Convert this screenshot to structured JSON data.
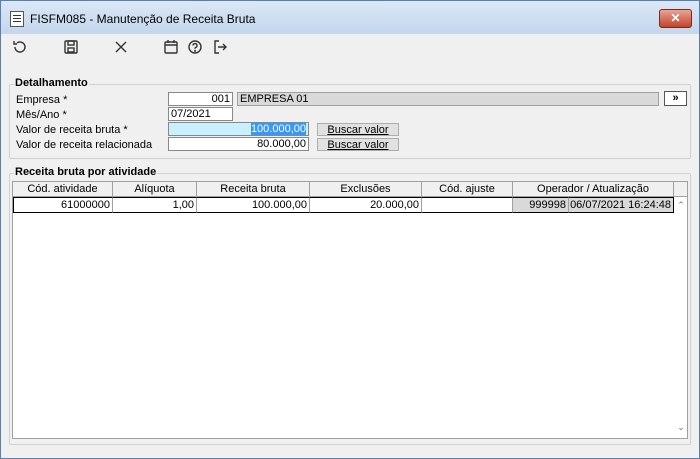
{
  "window": {
    "title": "FISFM085 - Manutenção de Receita Bruta",
    "close_label": "✕"
  },
  "toolbar": {
    "items": [
      {
        "name": "undo-icon"
      },
      {
        "name": "save-icon"
      },
      {
        "name": "delete-icon"
      },
      {
        "name": "calendar-icon"
      },
      {
        "name": "help-icon"
      },
      {
        "name": "exit-icon"
      }
    ]
  },
  "detail": {
    "legend": "Detalhamento",
    "empresa_label": "Empresa *",
    "empresa_code": "001",
    "empresa_name": "EMPRESA 01",
    "empresa_go": "»",
    "mesano_label": "Mês/Ano *",
    "mesano_value": "07/2021",
    "receita_bruta_label": "Valor de receita bruta *",
    "receita_bruta_value": "100.000,00",
    "receita_rel_label": "Valor de receita relacionada",
    "receita_rel_value": "80.000,00",
    "buscar_label_1": "Buscar valor",
    "buscar_label_2": "Buscar valor"
  },
  "grid": {
    "legend": "Receita bruta por atividade",
    "columns": [
      "Cód. atividade",
      "Alíquota",
      "Receita bruta",
      "Exclusões",
      "Cód. ajuste",
      "Operador / Atualização"
    ],
    "rows": [
      {
        "cod_atividade": "61000000",
        "aliquota": "1,00",
        "receita_bruta": "100.000,00",
        "exclusoes": "20.000,00",
        "cod_ajuste": "",
        "operador": "999998",
        "atualizacao": "06/07/2021 16:24:48"
      }
    ]
  }
}
